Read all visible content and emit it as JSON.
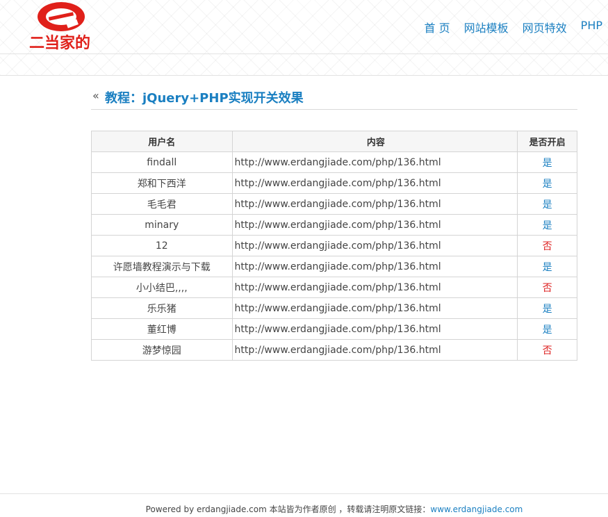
{
  "brand": {
    "logo_text": "二当家的",
    "color": "#e0201a"
  },
  "nav": {
    "items": [
      "首 页",
      "网站模板",
      "网页特效",
      "PHP"
    ]
  },
  "page": {
    "title_icon": "«",
    "title": "教程：jQuery+PHP实现开关效果"
  },
  "table": {
    "headers": [
      "用户名",
      "内容",
      "是否开启"
    ],
    "rows": [
      {
        "user": "findall",
        "content": "http://www.erdangjiade.com/php/136.html",
        "status": "是",
        "on": true
      },
      {
        "user": "郑和下西洋",
        "content": "http://www.erdangjiade.com/php/136.html",
        "status": "是",
        "on": true
      },
      {
        "user": "毛毛君",
        "content": "http://www.erdangjiade.com/php/136.html",
        "status": "是",
        "on": true
      },
      {
        "user": "minary",
        "content": "http://www.erdangjiade.com/php/136.html",
        "status": "是",
        "on": true
      },
      {
        "user": "12",
        "content": "http://www.erdangjiade.com/php/136.html",
        "status": "否",
        "on": false
      },
      {
        "user": "许愿墙教程演示与下载",
        "content": "http://www.erdangjiade.com/php/136.html",
        "status": "是",
        "on": true
      },
      {
        "user": "小小结巴,,,,",
        "content": "http://www.erdangjiade.com/php/136.html",
        "status": "否",
        "on": false
      },
      {
        "user": "乐乐猪",
        "content": "http://www.erdangjiade.com/php/136.html",
        "status": "是",
        "on": true
      },
      {
        "user": "董红博",
        "content": "http://www.erdangjiade.com/php/136.html",
        "status": "是",
        "on": true
      },
      {
        "user": "游梦惊园",
        "content": "http://www.erdangjiade.com/php/136.html",
        "status": "否",
        "on": false
      }
    ]
  },
  "footer": {
    "text": "Powered by erdangjiade.com 本站皆为作者原创 ，转载请注明原文链接：",
    "link": "www.erdangjiade.com"
  },
  "colors": {
    "accent": "#1a7fc1",
    "off": "#dd2222"
  }
}
